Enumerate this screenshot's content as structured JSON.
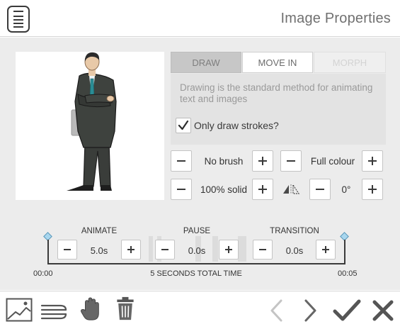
{
  "header": {
    "title": "Image Properties",
    "menu_icon": "notepad-menu-icon"
  },
  "tabs": [
    {
      "label": "DRAW",
      "state": "active"
    },
    {
      "label": "MOVE IN",
      "state": "normal"
    },
    {
      "label": "MORPH",
      "state": "disabled"
    }
  ],
  "description": "Drawing is the standard method for animating text and images",
  "only_strokes": {
    "label": "Only draw strokes?",
    "checked": true
  },
  "brush": {
    "value": "No brush"
  },
  "colour": {
    "value": "Full colour"
  },
  "opacity": {
    "value": "100% solid"
  },
  "rotation": {
    "value": "0°",
    "flip_icon": "flip-icon"
  },
  "timeline": {
    "animate": {
      "label": "ANIMATE",
      "value": "5.0s"
    },
    "pause": {
      "label": "PAUSE",
      "value": "0.0s"
    },
    "transition": {
      "label": "TRANSITION",
      "value": "0.0s"
    },
    "start_time": "00:00",
    "total": "5 SECONDS TOTAL TIME",
    "end_time": "00:05"
  },
  "footer": {
    "icons": [
      "image-icon",
      "text-lines-icon",
      "hand-icon",
      "trash-icon"
    ],
    "nav_icons": [
      "prev-icon",
      "next-icon",
      "confirm-icon",
      "close-icon"
    ]
  },
  "colors": {
    "accent_diamond": "#a8d6ee",
    "panel_bg": "#ececec",
    "active_tab": "#c7c7c7"
  }
}
